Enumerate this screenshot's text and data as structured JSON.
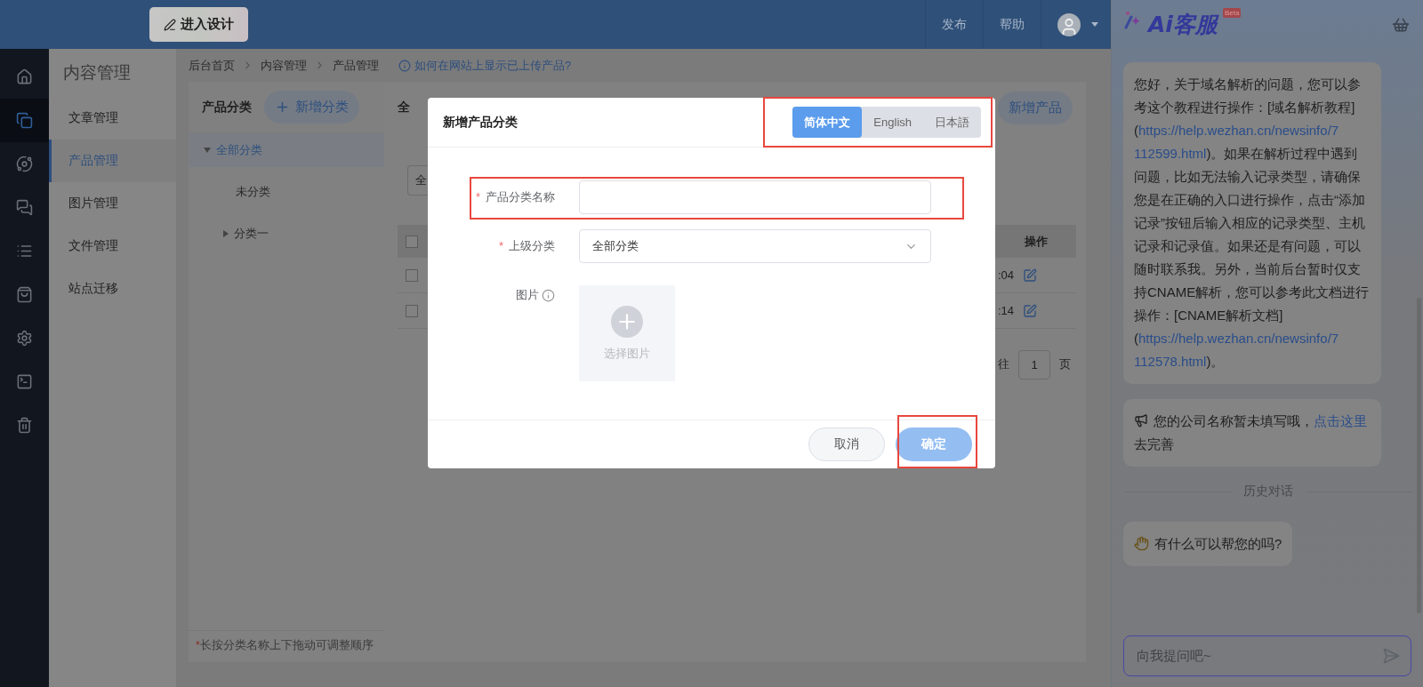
{
  "top_bar": {
    "design_button": "进入设计",
    "links": [
      "发布",
      "帮助"
    ]
  },
  "icon_rail": [
    {
      "kind": "home",
      "selected": false
    },
    {
      "kind": "files",
      "selected": true
    },
    {
      "kind": "planet",
      "selected": false
    },
    {
      "kind": "chat",
      "selected": false
    },
    {
      "kind": "list",
      "selected": false
    },
    {
      "kind": "bag",
      "selected": false
    },
    {
      "kind": "gear",
      "selected": false
    },
    {
      "kind": "terminal",
      "selected": false
    },
    {
      "kind": "trash",
      "selected": false
    }
  ],
  "sidebar": {
    "title": "内容管理",
    "items": [
      {
        "label": "文章管理",
        "selected": false
      },
      {
        "label": "产品管理",
        "selected": true
      },
      {
        "label": "图片管理",
        "selected": false
      },
      {
        "label": "文件管理",
        "selected": false
      },
      {
        "label": "站点迁移",
        "selected": false
      }
    ]
  },
  "breadcrumb": {
    "items": [
      "后台首页",
      "内容管理",
      "产品管理"
    ],
    "help_link": "如何在网站上显示已上传产品?"
  },
  "category_panel": {
    "title": "产品分类",
    "add_button": "新增分类",
    "tree": [
      {
        "label": "全部分类",
        "expanded": true,
        "selected": true,
        "children": [
          {
            "label": "未分类",
            "selected": false
          },
          {
            "label": "分类一",
            "expanded": false,
            "selected": false
          }
        ]
      }
    ],
    "hint": {
      "mark": "*",
      "text": "长按分类名称上下拖动可调整顺序"
    }
  },
  "product_panel": {
    "title": "全",
    "add_button": "新增产品",
    "filter_value": "全",
    "table": {
      "header_checked": false,
      "action_column": "操作",
      "rows": [
        {
          "time": ":04",
          "checked": false
        },
        {
          "time": ":14",
          "checked": false
        }
      ]
    },
    "pagination": {
      "goto": "往",
      "page": "1",
      "suffix": "页"
    }
  },
  "dialog": {
    "title": "新增产品分类",
    "languages_highlighted": true,
    "languages": [
      {
        "label": "简体中文",
        "selected": true
      },
      {
        "label": "English",
        "selected": false
      },
      {
        "label": "日本語",
        "selected": false
      }
    ],
    "fields": [
      {
        "kind": "text",
        "label": "产品分类名称",
        "required": true,
        "highlighted": true
      },
      {
        "kind": "select",
        "label": "上级分类",
        "required": true,
        "value": "全部分类"
      },
      {
        "kind": "image",
        "label": "图片",
        "required": false,
        "upload_label": "选择图片"
      }
    ],
    "buttons": [
      {
        "label": "取消",
        "kind": "secondary"
      },
      {
        "label": "确定",
        "kind": "primary",
        "highlighted": true
      }
    ]
  },
  "chat": {
    "title": "Ai客服",
    "badge": "Beta",
    "messages": [
      {
        "kind": "plain",
        "segments": [
          {
            "kind": "text",
            "text": "您好，关于域名解析的问题，您可以参考这个教程进行操作：[域名解析教程]("
          },
          {
            "kind": "link",
            "text": "https://help.wezhan.cn/newsinfo/7"
          },
          {
            "kind": "link",
            "text": "112599.html"
          },
          {
            "kind": "text",
            "text": ")。如果在解析过程中遇到问题，比如无法输入记录类型，请确保您是在正确的入口进行操作，点击“添加记录”按钮后输入相应的记录类型、主机记录和记录值。如果还是有问题，可以随时联系我。另外，当前后台暂时仅支持CNAME解析，您可以参考此文档进行操作：[CNAME解析文档]("
          },
          {
            "kind": "link",
            "text": "https://help.wezhan.cn/newsinfo/7"
          },
          {
            "kind": "link",
            "text": "112578.html"
          },
          {
            "kind": "text",
            "text": ")。"
          }
        ]
      },
      {
        "kind": "megaphone",
        "segments": [
          {
            "kind": "text",
            "text": "您的公司名称暂未填写哦，"
          },
          {
            "kind": "link",
            "text": "点击这里"
          },
          {
            "kind": "text",
            "text": " 去完善"
          }
        ]
      },
      {
        "kind": "divider",
        "label": "历史对话"
      },
      {
        "kind": "clap",
        "segments": [
          {
            "kind": "text",
            "text": "有什么可以帮您的吗?"
          }
        ]
      }
    ],
    "input_placeholder": "向我提问吧~"
  }
}
